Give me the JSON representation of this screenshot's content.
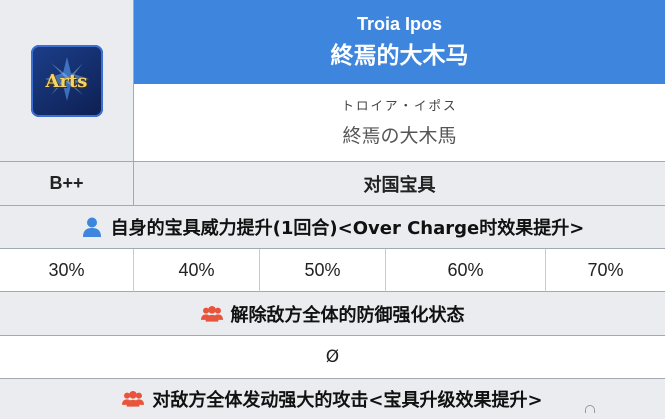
{
  "noble_phantasm": {
    "card_type": "Arts",
    "card_color": "#1b3f8a",
    "name_en": "Troia Ipos",
    "name_zh": "終焉的大木马",
    "ruby_jp": "トロイア・イポス",
    "name_jp": "終焉の大木馬",
    "rank": "B++",
    "np_type": "对国宝具",
    "header_color": "#3e86dd"
  },
  "effects": [
    {
      "icon": "user-icon",
      "icon_color": "#3e86dd",
      "text": "自身的宝具威力提升(1回合)<Over Charge时效果提升>",
      "values": [
        "30%",
        "40%",
        "50%",
        "60%",
        "70%"
      ]
    },
    {
      "icon": "users-icon",
      "icon_color": "#e8553d",
      "text": "解除敌方全体的防御强化状态",
      "values": [
        "Ø"
      ]
    },
    {
      "icon": "users-icon",
      "icon_color": "#e8553d",
      "text": "对敌方全体发动强大的攻击<宝具升级效果提升>",
      "values": []
    }
  ]
}
